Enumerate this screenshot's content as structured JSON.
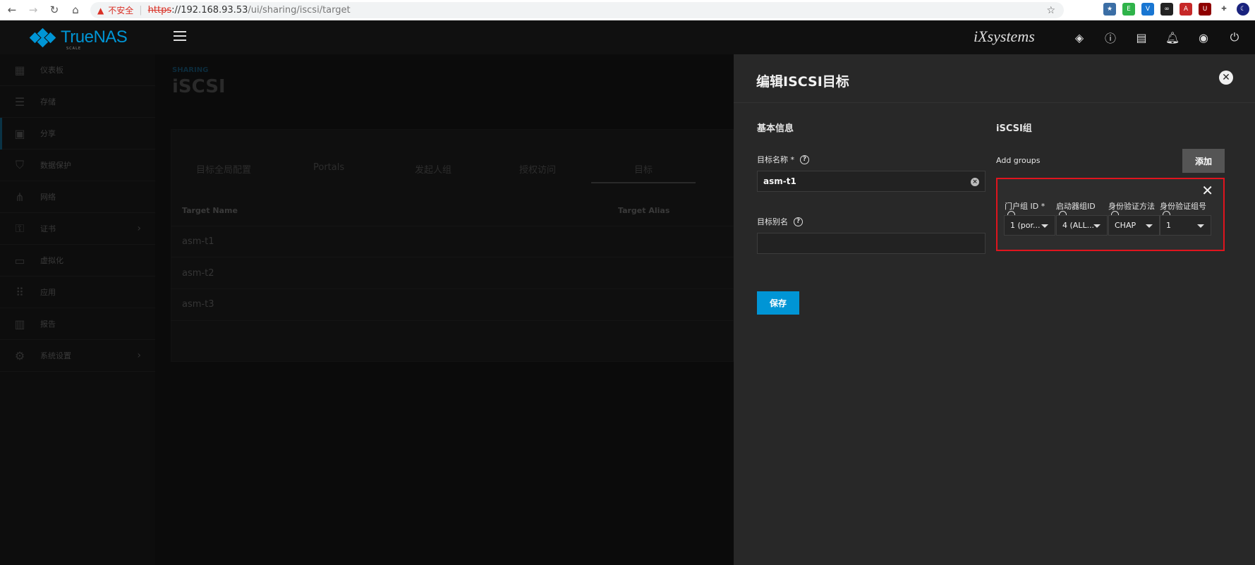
{
  "browser": {
    "insecure_label": "不安全",
    "url_proto": "https",
    "url_host": "://192.168.93.53",
    "url_path": "/ui/sharing/iscsi/target"
  },
  "app": {
    "logo_text": "TrueNAS",
    "logo_sub": "SCALE",
    "vendor": "iXsystems"
  },
  "sidebar": {
    "items": [
      {
        "label": "仪表板",
        "icon": "dashboard-icon"
      },
      {
        "label": "存储",
        "icon": "storage-icon"
      },
      {
        "label": "分享",
        "icon": "share-icon"
      },
      {
        "label": "数据保护",
        "icon": "shield-icon"
      },
      {
        "label": "网络",
        "icon": "network-icon"
      },
      {
        "label": "证书",
        "icon": "key-icon"
      },
      {
        "label": "虚拟化",
        "icon": "laptop-icon"
      },
      {
        "label": "应用",
        "icon": "apps-icon"
      },
      {
        "label": "报告",
        "icon": "report-icon"
      },
      {
        "label": "系统设置",
        "icon": "gear-icon"
      }
    ]
  },
  "main": {
    "breadcrumb": "SHARING",
    "title": "iSCSI",
    "tabs": [
      "目标全局配置",
      "Portals",
      "发起人组",
      "授权访问",
      "目标"
    ],
    "columns": [
      "Target Name",
      "Target Alias"
    ],
    "rows": [
      "asm-t1",
      "asm-t2",
      "asm-t3"
    ]
  },
  "panel": {
    "title": "编辑ISCSI目标",
    "basic_section": "基本信息",
    "target_name_label": "目标名称 *",
    "target_name_value": "asm-t1",
    "target_alias_label": "目标别名",
    "target_alias_value": "",
    "save_label": "保存",
    "groups_section": "iSCSI组",
    "add_groups_label": "Add groups",
    "add_label": "添加",
    "group": {
      "portal_label": "门户组 ID *",
      "portal_value": "1 (por...",
      "initiator_label": "启动器组ID",
      "initiator_value": "4 (ALL...",
      "auth_method_label": "身份验证方法",
      "auth_method_value": "CHAP",
      "auth_group_label": "身份验证组号",
      "auth_group_value": "1"
    }
  }
}
